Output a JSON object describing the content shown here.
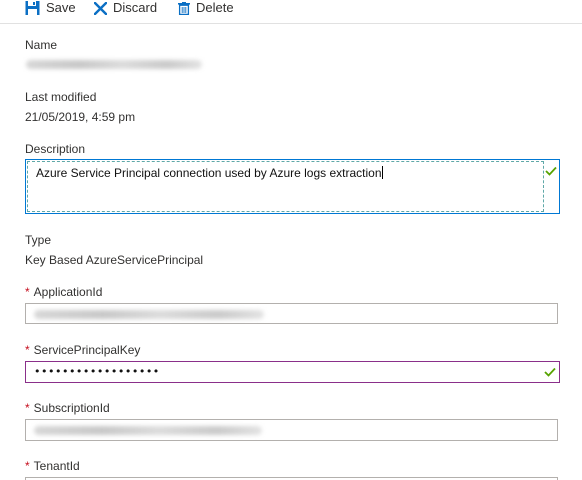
{
  "toolbar": {
    "save_label": "Save",
    "discard_label": "Discard",
    "delete_label": "Delete"
  },
  "form": {
    "name": {
      "label": "Name"
    },
    "last_modified": {
      "label": "Last modified",
      "value": "21/05/2019, 4:59 pm"
    },
    "description": {
      "label": "Description",
      "value": "Azure Service Principal connection used by Azure logs extraction"
    },
    "type": {
      "label": "Type",
      "value": "Key Based AzureServicePrincipal"
    },
    "application_id": {
      "label": "ApplicationId",
      "required_mark": "*"
    },
    "service_principal_key": {
      "label": "ServicePrincipalKey",
      "required_mark": "*",
      "masked_value": "••••••••••••••••••"
    },
    "subscription_id": {
      "label": "SubscriptionId",
      "required_mark": "*"
    },
    "tenant_id": {
      "label": "TenantId",
      "required_mark": "*"
    }
  },
  "colors": {
    "accent": "#0078d4",
    "required": "#c50f1f",
    "valid_check": "#57a300",
    "focus_border": "#8a2f8a"
  },
  "icons": {
    "save": "save-disk-icon",
    "discard": "x-icon",
    "delete": "trash-icon",
    "valid": "checkmark-icon"
  }
}
